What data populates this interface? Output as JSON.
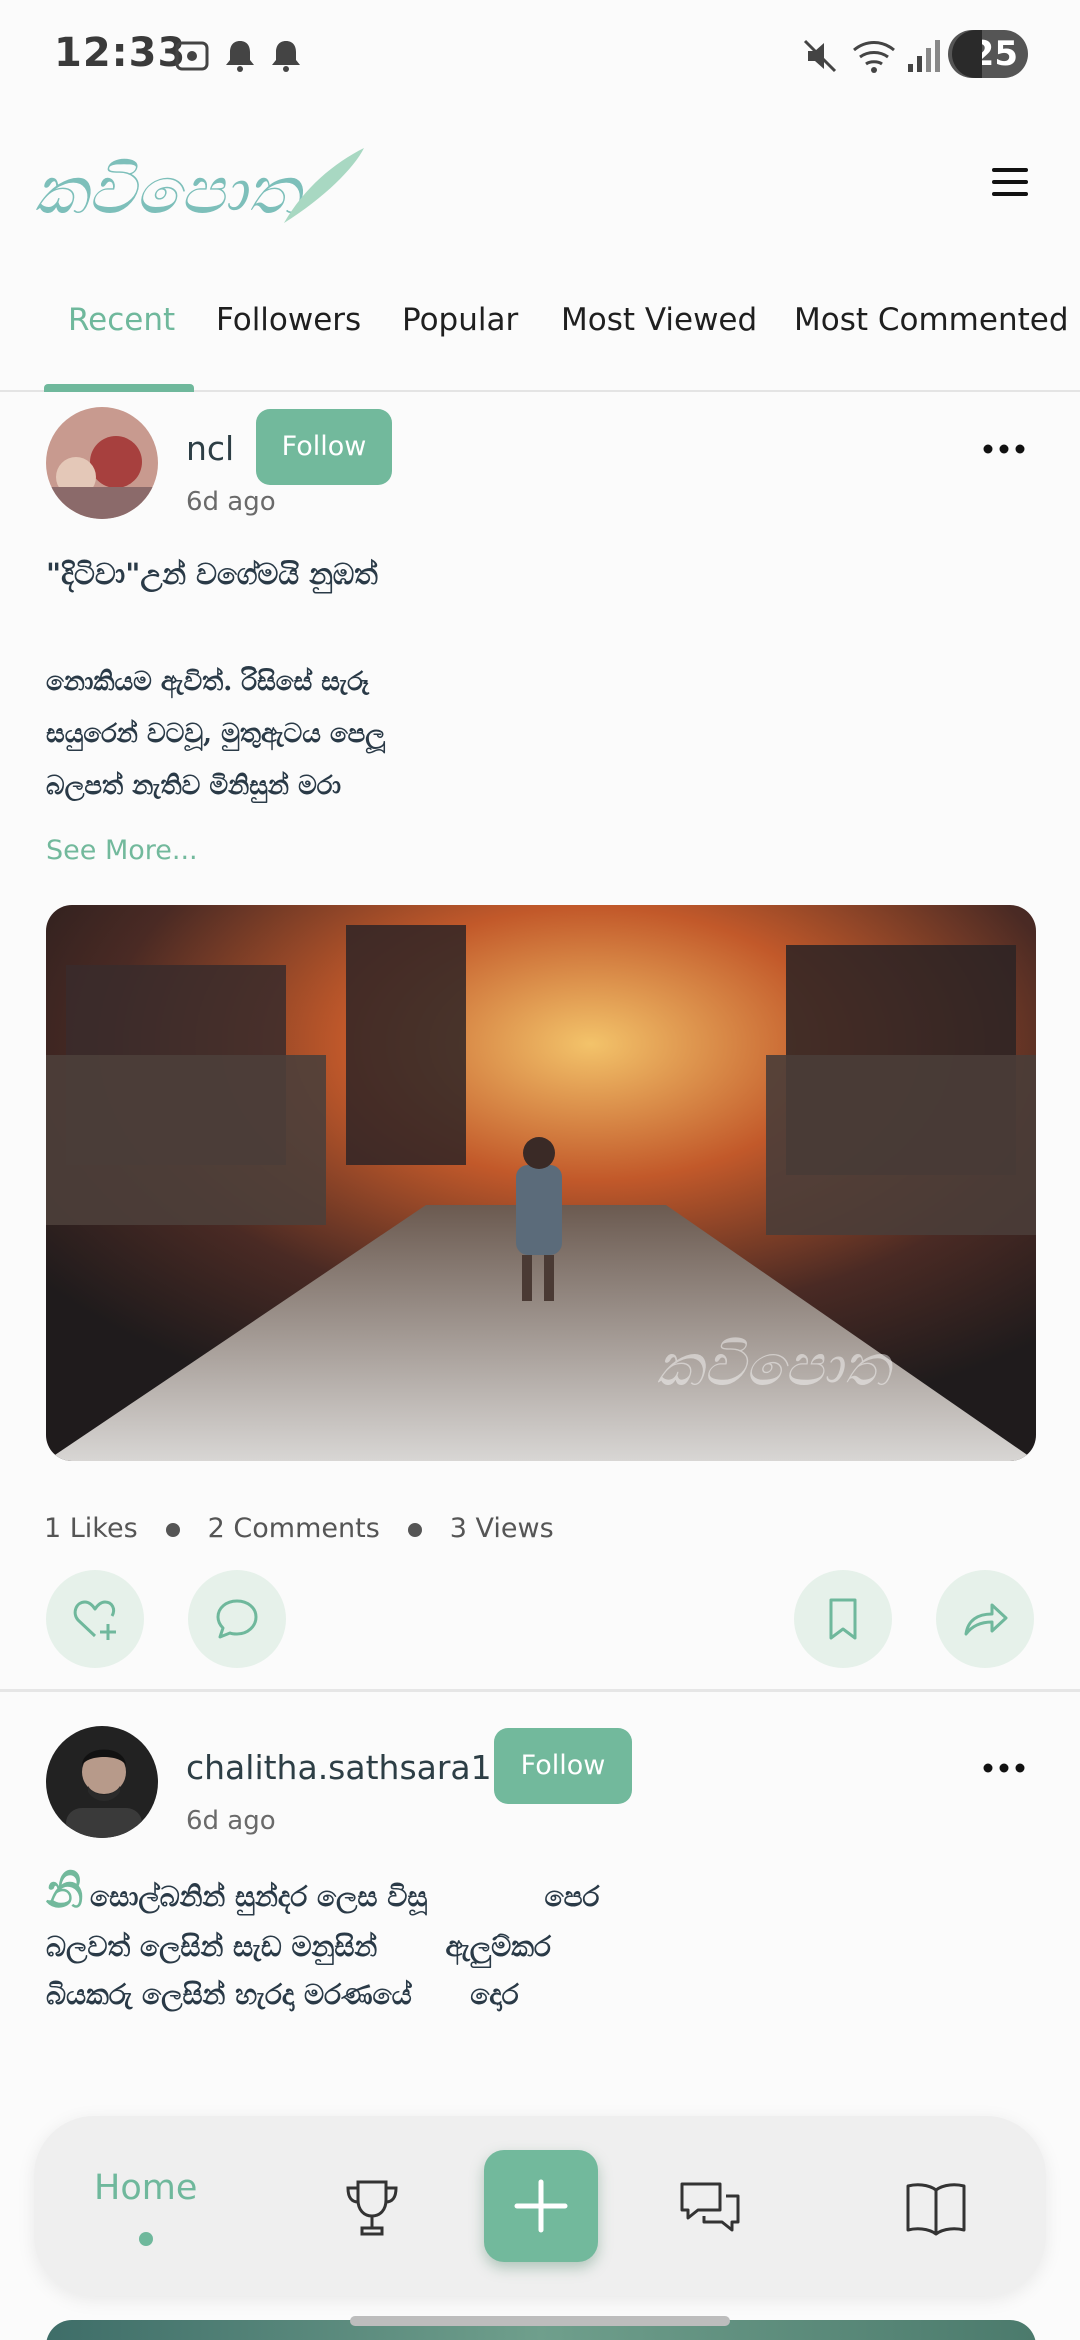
{
  "status_bar": {
    "time": "12:33",
    "battery": "25",
    "icons": [
      "screenshot-icon",
      "bell-icon",
      "bell-icon",
      "mute-icon",
      "wifi-icon",
      "signal-icon",
      "battery-icon"
    ]
  },
  "header": {
    "logo_text": "කවිපොත",
    "menu_icon": "hamburger-menu-icon"
  },
  "tabs": [
    {
      "label": "Recent",
      "active": true
    },
    {
      "label": "Followers",
      "active": false
    },
    {
      "label": "Popular",
      "active": false
    },
    {
      "label": "Most Viewed",
      "active": false
    },
    {
      "label": "Most Commented",
      "active": false
    }
  ],
  "posts": [
    {
      "username": "ncl",
      "follow_label": "Follow",
      "time_ago": "6d ago",
      "lines": [
        "\"දිටිවා\"උන් වගේමයි නුඹත්",
        "",
        "නොකියම ඇවිත්. රිසිසේ සැරූ",
        "සයුරෙන් වටවූ, මුතුඇටය පෙලූ",
        "බලපත් නැතිව මිනිසුන් මරා"
      ],
      "see_more": "See More...",
      "image_watermark": "කවිපොත",
      "stats": {
        "likes": "1 Likes",
        "comments": "2 Comments",
        "views": "3 Views"
      }
    },
    {
      "username": "chalitha.sathsara1",
      "follow_label": "Follow",
      "time_ago": "6d ago",
      "drop_cap": "නි",
      "lines": [
        "සොල්බනින් සුන්දර ලෙස විසූ            පෙර",
        "බලවත් ලෙසින් සැඩ මනුසින්       ඇලුම්කර",
        "බියකරු ලෙසින් හැරදා මරණයේ      දොර"
      ]
    }
  ],
  "bottom_nav": {
    "home_label": "Home",
    "items": [
      "trophy-icon",
      "add-icon",
      "chat-icon",
      "book-icon"
    ]
  },
  "colors": {
    "accent": "#72b99c",
    "action_bg": "#e6f1ea",
    "text_dark": "#2a3a47"
  }
}
